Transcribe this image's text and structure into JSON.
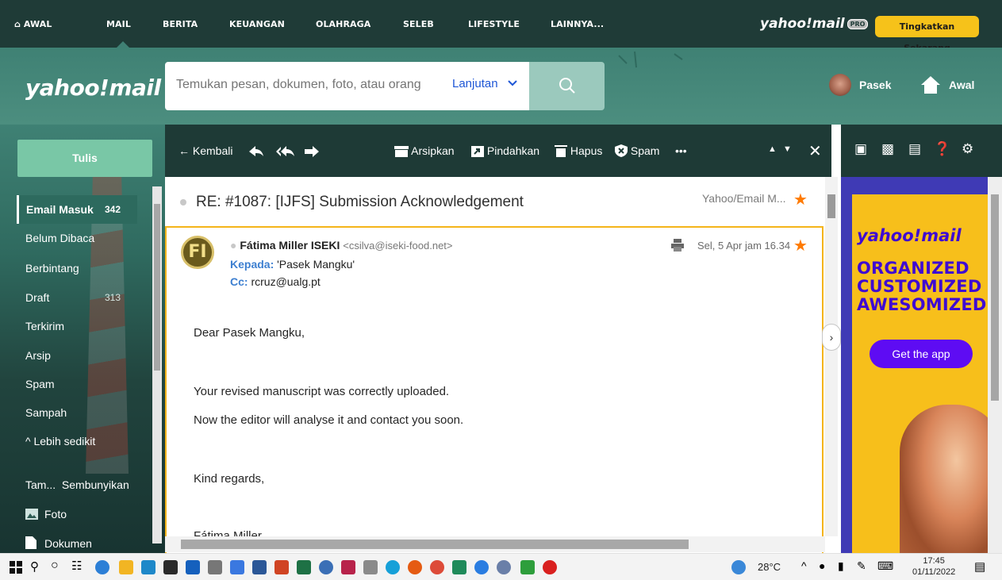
{
  "top_nav": {
    "items": [
      "AWAL",
      "MAIL",
      "BERITA",
      "KEUANGAN",
      "OLAHRAGA",
      "SELEB",
      "LIFESTYLE",
      "LAINNYA..."
    ],
    "brand": "yahoo!mail",
    "brand_badge": "PRO",
    "upgrade_label": "Tingkatkan Sekarang"
  },
  "header": {
    "logo": "yahoo!mail",
    "search_placeholder": "Temukan pesan, dokumen, foto, atau orang",
    "advanced_label": "Lanjutan",
    "user_name": "Pasek",
    "home_label": "Awal"
  },
  "sidebar": {
    "compose_label": "Tulis",
    "folders": [
      {
        "label": "Email Masuk",
        "count": "342"
      },
      {
        "label": "Belum Dibaca",
        "count": ""
      },
      {
        "label": "Berbintang",
        "count": ""
      },
      {
        "label": "Draft",
        "count": "313"
      },
      {
        "label": "Terkirim",
        "count": ""
      },
      {
        "label": "Arsip",
        "count": ""
      },
      {
        "label": "Spam",
        "count": ""
      },
      {
        "label": "Sampah",
        "count": ""
      }
    ],
    "less_label": "Lebih sedikit",
    "views_label": "Tam...",
    "hide_label": "Sembunyikan",
    "photos_label": "Foto",
    "documents_label": "Dokumen"
  },
  "toolbar": {
    "back_label": "Kembali",
    "archive_label": "Arsipkan",
    "move_label": "Pindahkan",
    "delete_label": "Hapus",
    "spam_label": "Spam",
    "more_label": "•••"
  },
  "message": {
    "subject": "RE: #1087: [IJFS] Submission Acknowledgement",
    "folder_tag": "Yahoo/Email M...",
    "avatar_initials": "FI",
    "sender_name": "Fátima Miller ISEKI",
    "sender_email": "<csilva@iseki-food.net>",
    "to_label": "Kepada:",
    "to_value": "'Pasek Mangku'",
    "cc_label": "Cc:",
    "cc_value": "rcruz@ualg.pt",
    "date": "Sel, 5 Apr jam 16.34",
    "body": [
      "Dear Pasek Mangku,",
      "Your revised manuscript was correctly uploaded.",
      "Now the editor will analyse it and contact you soon.",
      "Kind regards,",
      "Fátima Miller"
    ]
  },
  "ad": {
    "logo": "yahoo!mail",
    "lines": [
      "ORGANIZED",
      "CUSTOMIZED",
      "AWESOMIZED"
    ],
    "button_label": "Get the app"
  },
  "taskbar": {
    "weather": "28°C",
    "time": "17:45",
    "date": "01/11/2022"
  },
  "colors": {
    "nav_bg": "#1f3b37",
    "header_bg": "#3f8174",
    "accent_orange": "#ff7a00",
    "upgrade_yellow": "#f6c21a",
    "ad_purple": "#5e0cf3"
  }
}
